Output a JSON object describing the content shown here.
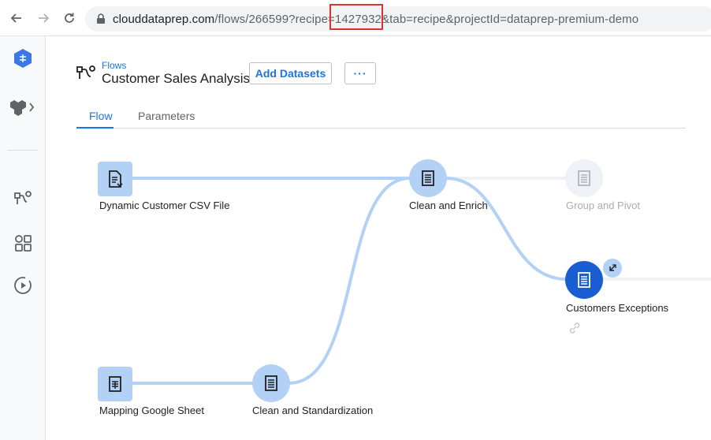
{
  "browser": {
    "url_host": "clouddataprep.com",
    "url_path_before": "/flows/266599?recipe=",
    "url_recipe_id": "1427932",
    "url_path_after": "&tab=recipe&projectId=dataprep-premium-demo"
  },
  "rail": {
    "items": [
      "logo-icon",
      "datasets-icon",
      "flows-icon",
      "library-icon",
      "jobs-icon"
    ]
  },
  "header": {
    "breadcrumb": "Flows",
    "title": "Customer Sales Analysis",
    "add_datasets_label": "Add Datasets",
    "more_label": "···"
  },
  "tabs": [
    {
      "label": "Flow",
      "active": true
    },
    {
      "label": "Parameters",
      "active": false
    }
  ],
  "nodes": {
    "dynamic_csv": {
      "label": "Dynamic Customer CSV File"
    },
    "clean_enrich": {
      "label": "Clean and Enrich"
    },
    "group_pivot": {
      "label": "Group and Pivot"
    },
    "customers_exceptions": {
      "label": "Customers Exceptions"
    },
    "mapping_sheet": {
      "label": "Mapping Google Sheet"
    },
    "clean_standardization": {
      "label": "Clean and Standardization"
    }
  },
  "colors": {
    "accent": "#1a73e8",
    "edge": "#b3d1f5",
    "highlight": "#e0312b"
  }
}
